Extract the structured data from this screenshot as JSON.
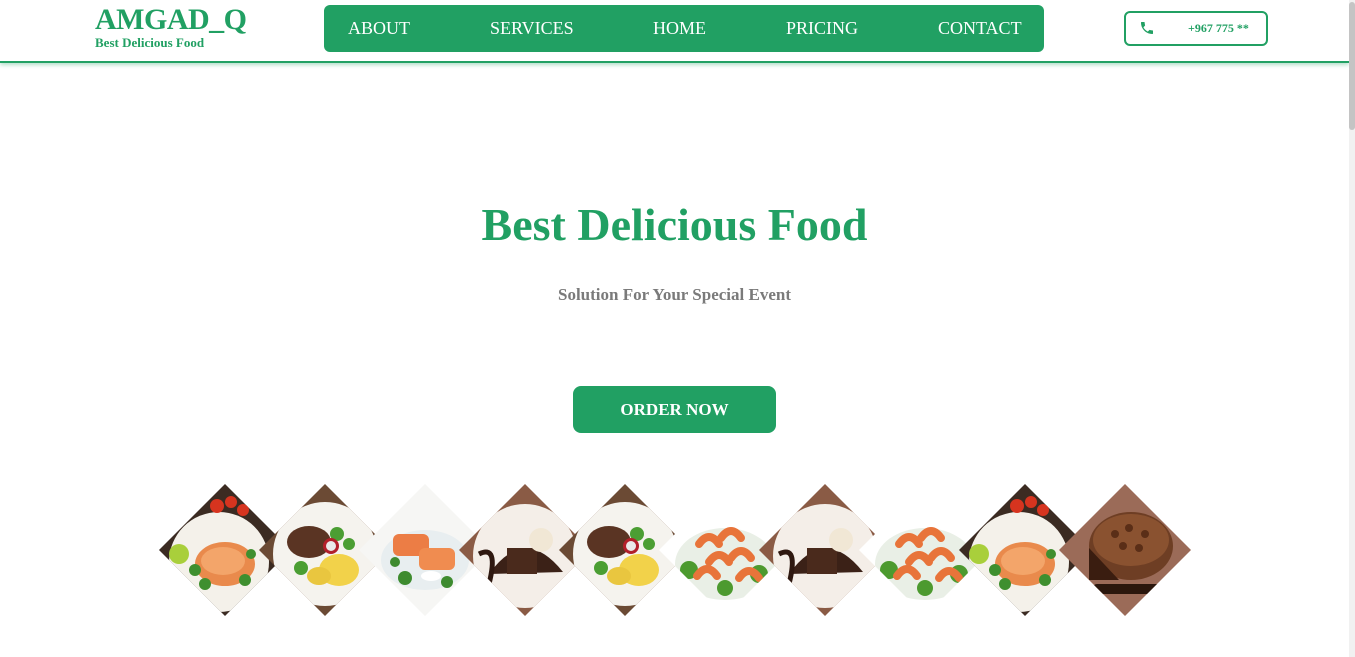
{
  "brand": {
    "title": "AMGAD_Q",
    "subtitle": "Best Delicious Food"
  },
  "nav": {
    "items": [
      "ABOUT",
      "SERVICES",
      "HOME",
      "PRICING",
      "CONTACT"
    ]
  },
  "contact": {
    "phone": "+967 775 **",
    "icon": "phone-icon"
  },
  "hero": {
    "title": "Best Delicious Food",
    "subtitle": "Solution For Your Special Event",
    "cta": "ORDER NOW"
  },
  "gallery": {
    "dishes": [
      "salmon-plate",
      "steak-potato",
      "salmon-fillet",
      "chocolate-cake",
      "steak-potato",
      "shrimp",
      "chocolate-cake",
      "shrimp",
      "salmon-plate",
      "chocolate-layer-cake"
    ]
  },
  "colors": {
    "accent": "#21a063",
    "muted": "#7a7a7a",
    "background": "#ffffff"
  }
}
